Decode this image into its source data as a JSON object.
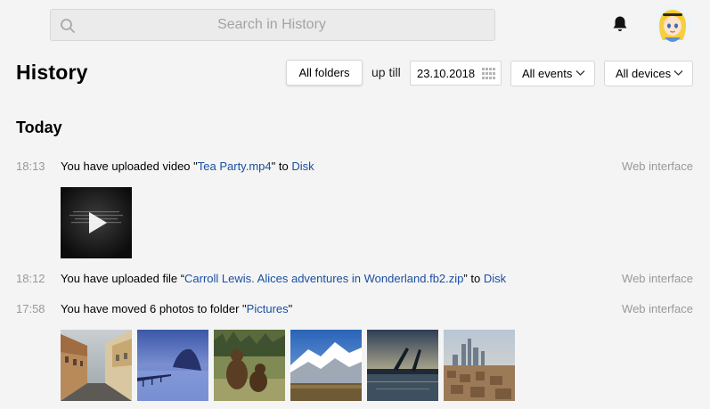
{
  "search": {
    "placeholder": "Search in History",
    "value": ""
  },
  "header": {
    "bell_icon": "bell-icon",
    "avatar": "user-avatar"
  },
  "page": {
    "title": "History"
  },
  "filters": {
    "folders_label": "All folders",
    "up_till_label": "up till",
    "date_value": "23.10.2018",
    "events_label": "All events",
    "devices_label": "All devices"
  },
  "section": {
    "title": "Today"
  },
  "events": [
    {
      "time": "18:13",
      "prefix": "You have uploaded video \"",
      "item": "Tea Party.mp4",
      "middle": "\" to ",
      "target": "Disk",
      "suffix": "",
      "source": "Web interface"
    },
    {
      "time": "18:12",
      "prefix": "You have uploaded file “",
      "item": "Carroll Lewis. Alices adventures in Wonderland.fb2.zip",
      "middle": "” to ",
      "target": "Disk",
      "suffix": "",
      "source": "Web interface"
    },
    {
      "time": "17:58",
      "prefix": "You have moved 6 photos to folder \"",
      "item": "Pictures",
      "middle": "\"",
      "target": "",
      "suffix": "",
      "source": "Web interface"
    }
  ],
  "colors": {
    "link": "#1a4fa0",
    "muted": "#999999",
    "background": "#f4f4f4"
  }
}
